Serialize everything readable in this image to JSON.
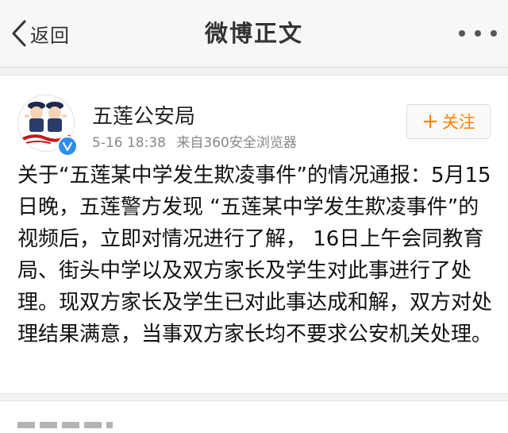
{
  "nav": {
    "back_label": "返回",
    "title": "微博正文"
  },
  "post": {
    "user_name": "五莲公安局",
    "time": "5-16 18:38",
    "source": "来自360安全浏览器",
    "follow_label": "关注",
    "follow_icon": "plus-icon",
    "avatar_icon": "police-officers-avatar",
    "verified_icon": "verified-v-badge",
    "text": "关于“五莲某中学发生欺凌事件”的情况通报：5月15日晚，五莲警方发现 “五莲某中学发生欺凌事件”的视频后，立即对情况进行了解， 16日上午会同教育局、街头中学以及双方家长及学生对此事进行了处理。现双方家长及学生已对此事达成和解，双方对处理结果满意，当事双方家长均不要求公安机关处理。"
  },
  "colors": {
    "follow_accent": "#ff8200",
    "verified_badge": "#2d8ee8",
    "page_background": "#f2f2f2"
  }
}
